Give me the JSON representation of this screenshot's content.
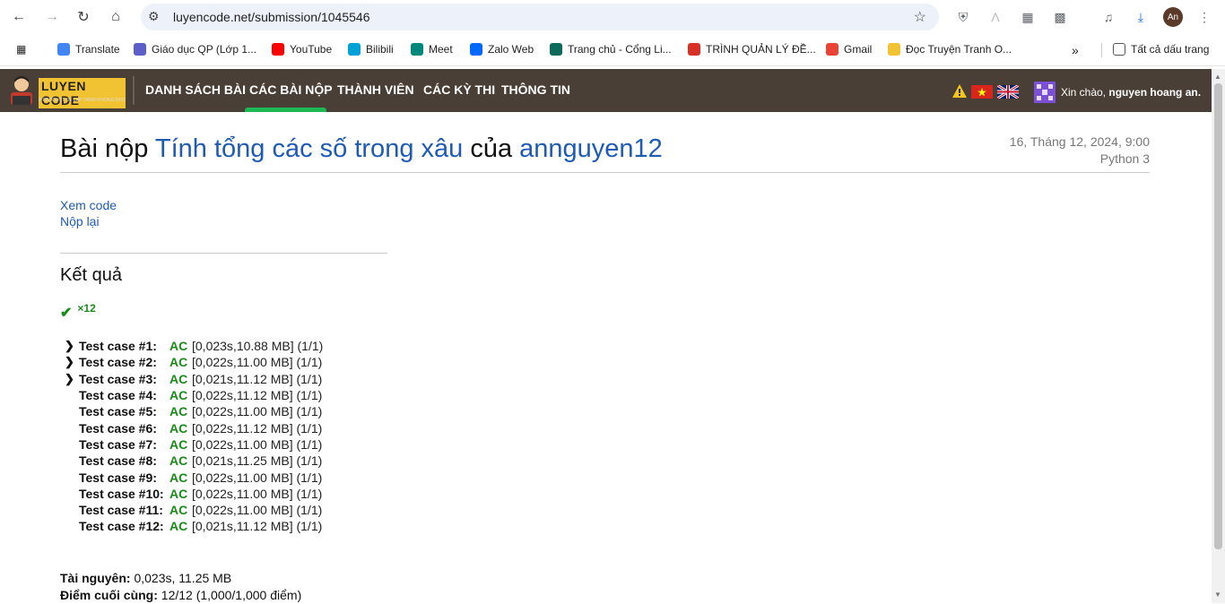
{
  "browser": {
    "url": "luyencode.net/submission/1045546",
    "avatar_initials": "An",
    "bookmarks": [
      {
        "label": "Translate",
        "icon": "translate-icon",
        "color": "#4285f4"
      },
      {
        "label": "Giáo dục QP (Lớp 1...",
        "icon": "teams-icon",
        "color": "#5b5fc7"
      },
      {
        "label": "YouTube",
        "icon": "youtube-icon",
        "color": "#ff0000"
      },
      {
        "label": "Bilibili",
        "icon": "bilibili-icon",
        "color": "#00a1d6"
      },
      {
        "label": "Meet",
        "icon": "meet-icon",
        "color": "#00897b"
      },
      {
        "label": "Zalo Web",
        "icon": "zalo-icon",
        "color": "#0068ff"
      },
      {
        "label": "Trang chủ - Cổng Li...",
        "icon": "portal-icon",
        "color": "#0b6b5a"
      },
      {
        "label": "TRÌNH QUẢN LÝ ĐỀ...",
        "icon": "shield-icon",
        "color": "#d93025"
      },
      {
        "label": "Gmail",
        "icon": "gmail-icon",
        "color": "#ea4335"
      },
      {
        "label": "Đọc Truyện Tranh O...",
        "icon": "manga-icon",
        "color": "#f1c232"
      }
    ],
    "all_bookmarks_label": "Tất cả dấu trang"
  },
  "site": {
    "logo_text": "LUYEN CODE",
    "logo_sub": "A PRODUCT OF LAP TRINH KHONG KHO",
    "nav": [
      "DANH SÁCH BÀI",
      "CÁC BÀI NỘP",
      "THÀNH VIÊN",
      "CÁC KỲ THI",
      "THÔNG TIN"
    ],
    "greeting_prefix": "Xin chào, ",
    "greeting_user": "nguyen hoang an."
  },
  "submission": {
    "title_prefix": "Bài nộp ",
    "problem": "Tính tổng các số trong xâu",
    "title_mid": " của ",
    "user": "annguyen12",
    "date": "16, Tháng 12, 2024, 9:00",
    "language": "Python 3",
    "view_code": "Xem code",
    "resubmit": "Nộp lại",
    "result_title": "Kết quả",
    "summary_count": "×12",
    "cases": [
      {
        "label": "Test case #1:",
        "status": "AC",
        "info": "[0,023s,10.88 MB] (1/1)",
        "expandable": true
      },
      {
        "label": "Test case #2:",
        "status": "AC",
        "info": "[0,022s,11.00 MB] (1/1)",
        "expandable": true
      },
      {
        "label": "Test case #3:",
        "status": "AC",
        "info": "[0,021s,11.12 MB] (1/1)",
        "expandable": true
      },
      {
        "label": "Test case #4:",
        "status": "AC",
        "info": "[0,022s,11.12 MB] (1/1)",
        "expandable": false
      },
      {
        "label": "Test case #5:",
        "status": "AC",
        "info": "[0,022s,11.00 MB] (1/1)",
        "expandable": false
      },
      {
        "label": "Test case #6:",
        "status": "AC",
        "info": "[0,022s,11.12 MB] (1/1)",
        "expandable": false
      },
      {
        "label": "Test case #7:",
        "status": "AC",
        "info": "[0,022s,11.00 MB] (1/1)",
        "expandable": false
      },
      {
        "label": "Test case #8:",
        "status": "AC",
        "info": "[0,021s,11.25 MB] (1/1)",
        "expandable": false
      },
      {
        "label": "Test case #9:",
        "status": "AC",
        "info": "[0,022s,11.00 MB] (1/1)",
        "expandable": false
      },
      {
        "label": "Test case #10:",
        "status": "AC",
        "info": "[0,022s,11.00 MB] (1/1)",
        "expandable": false
      },
      {
        "label": "Test case #11:",
        "status": "AC",
        "info": "[0,022s,11.00 MB] (1/1)",
        "expandable": false
      },
      {
        "label": "Test case #12:",
        "status": "AC",
        "info": "[0,021s,11.12 MB] (1/1)",
        "expandable": false
      }
    ],
    "resources_label": "Tài nguyên:",
    "resources_value": " 0,023s, 11.25 MB",
    "final_score_label": "Điểm cuối cùng:",
    "final_score_value": " 12/12 (1,000/1,000 điểm)"
  }
}
